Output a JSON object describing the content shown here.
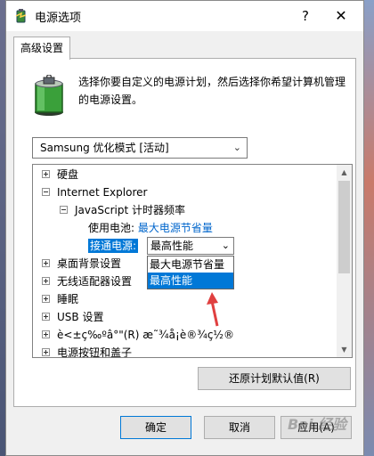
{
  "window": {
    "title": "电源选项",
    "help": "?",
    "close": "✕"
  },
  "tab": {
    "label": "高级设置"
  },
  "description": "选择你要自定义的电源计划，然后选择你希望计算机管理的电源设置。",
  "plan": {
    "selected": "Samsung 优化模式 [活动]"
  },
  "tree": {
    "harddisk": "硬盘",
    "ie": "Internet Explorer",
    "js_timer": "JavaScript 计时器频率",
    "battery_label": "使用电池:",
    "battery_value": "最大电源节省量",
    "plugged_label": "接通电源:",
    "plugged_value": "最高性能",
    "dropdown_options": [
      "最大电源节省量",
      "最高性能"
    ],
    "desktop_bg": "桌面背景设置",
    "wireless": "无线适配器设置",
    "sleep": "睡眠",
    "usb": "USB 设置",
    "garbled": "è<±ç‰ºâ°\"(R) æ˜¾å¡è®¾ç½®",
    "power_buttons": "电源按钮和盖子"
  },
  "buttons": {
    "restore": "还原计划默认值(R)",
    "ok": "确定",
    "cancel": "取消",
    "apply": "应用(A)"
  },
  "watermark": "Bai 经验",
  "colors": {
    "accent": "#0078d7",
    "link": "#0066cc",
    "annotation": "#e04040"
  }
}
